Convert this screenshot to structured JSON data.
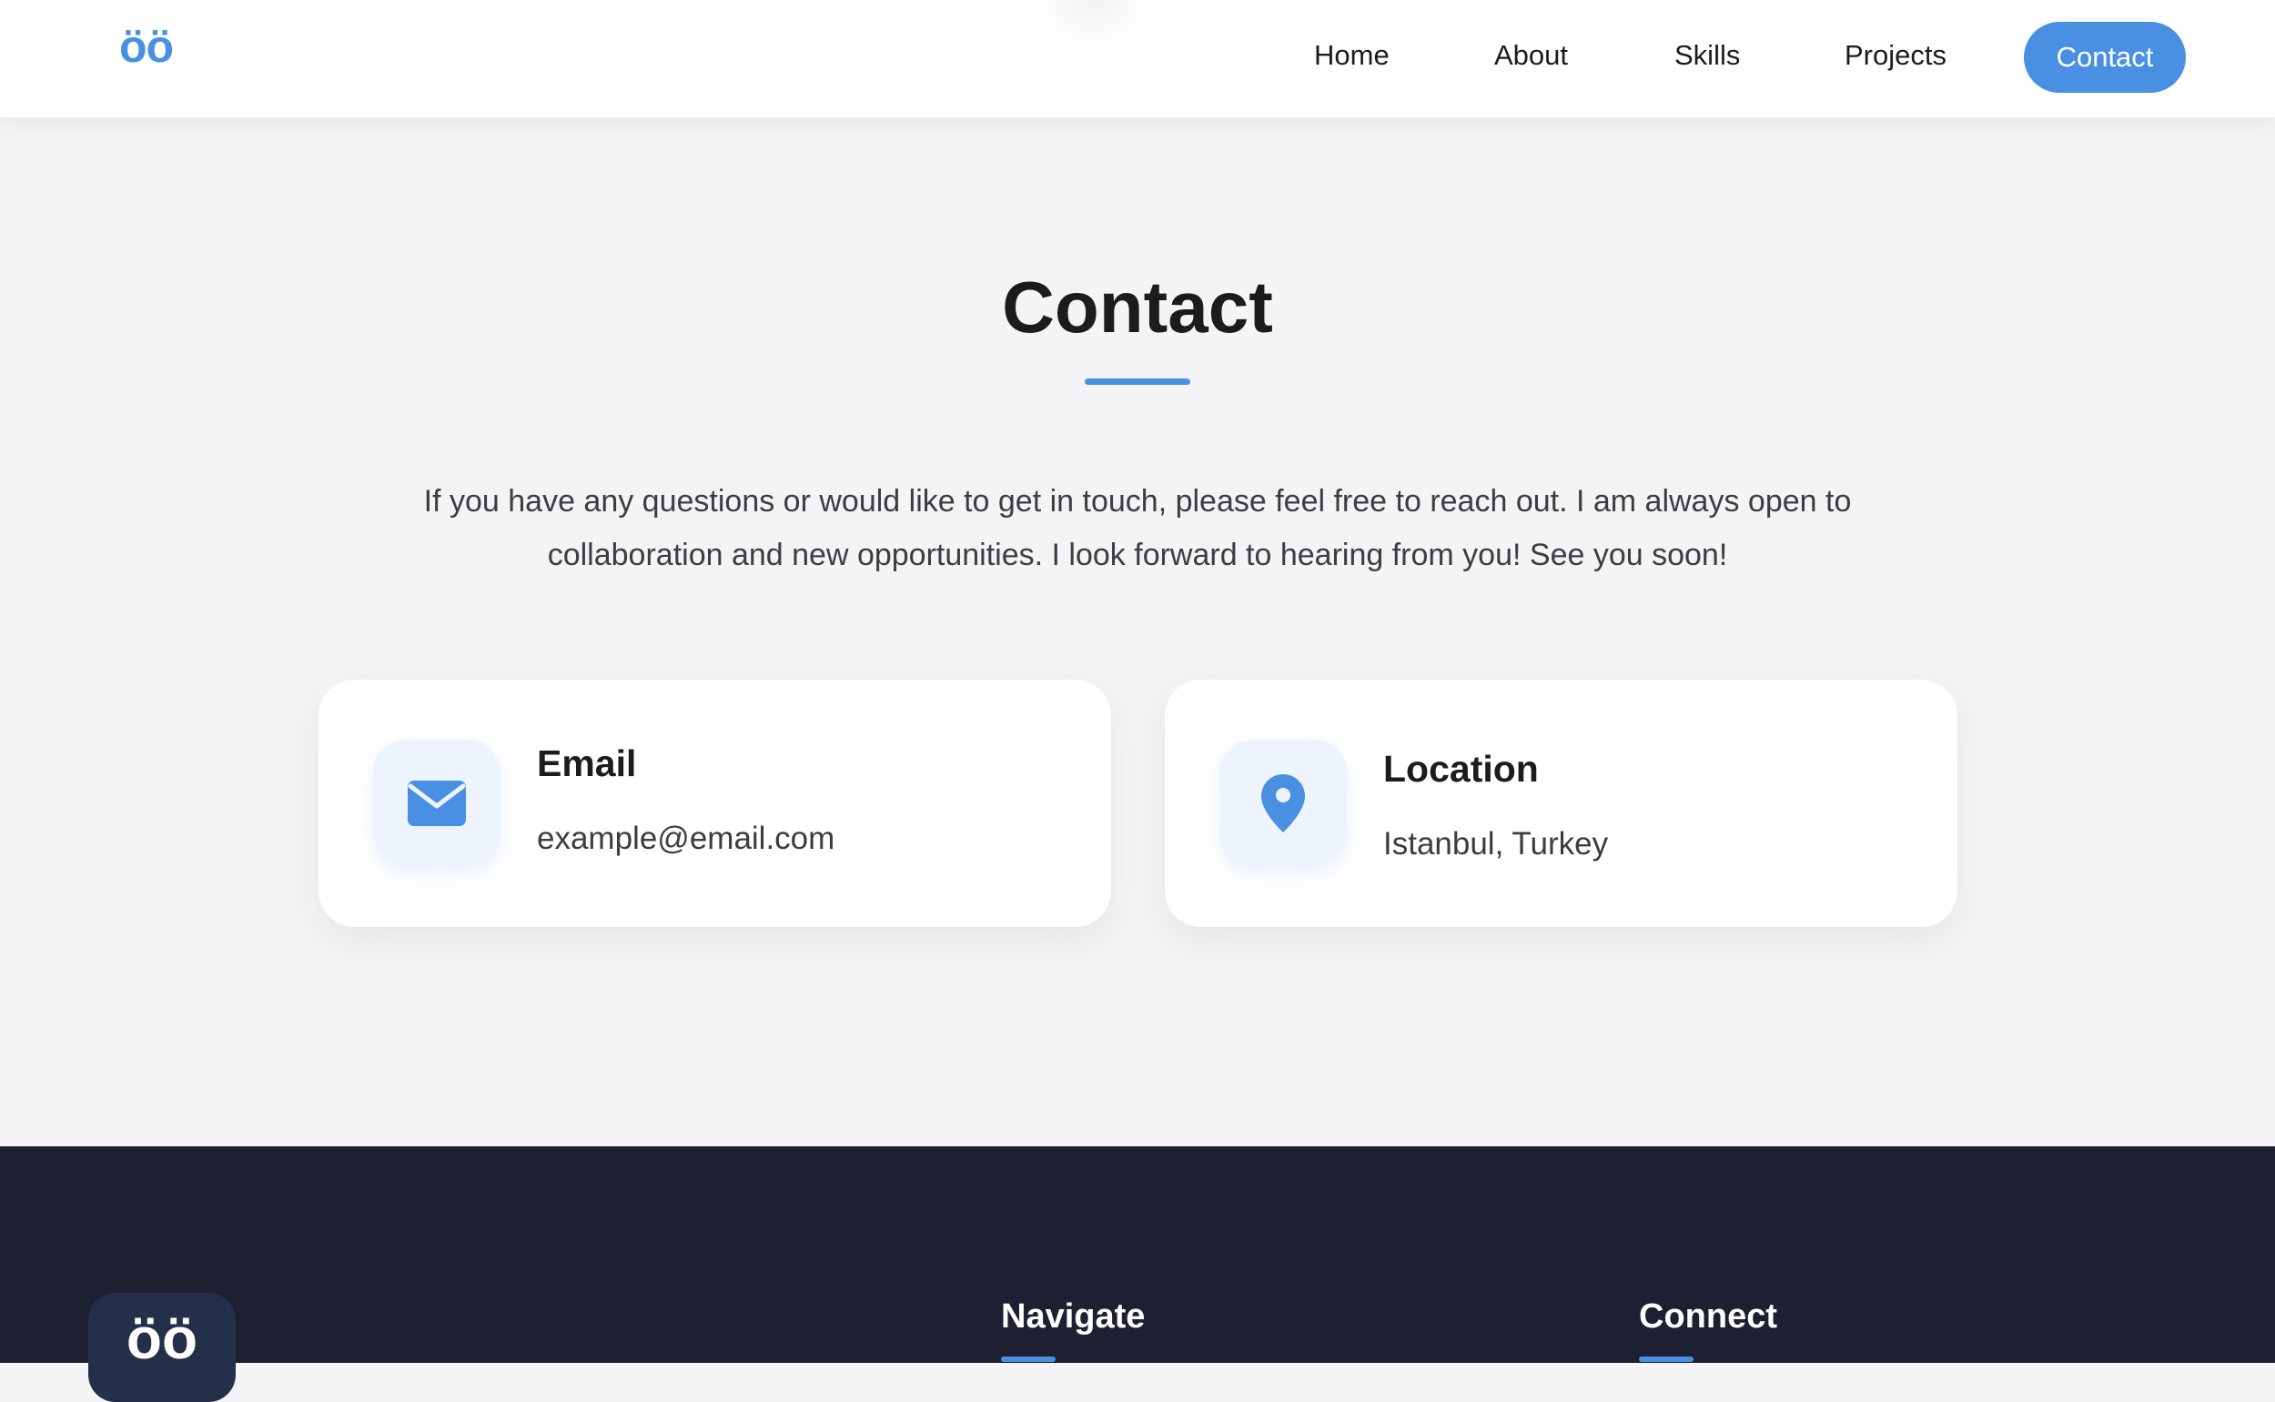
{
  "header": {
    "logo": "öö",
    "nav": [
      {
        "label": "Home"
      },
      {
        "label": "About"
      },
      {
        "label": "Skills"
      },
      {
        "label": "Projects"
      }
    ],
    "cta_label": "Contact"
  },
  "contact": {
    "title": "Contact",
    "intro": "If you have any questions or would like to get in touch, please feel free to reach out. I am always open to collaboration and new opportunities. I look forward to hearing from you! See you soon!",
    "cards": [
      {
        "icon": "envelope-icon",
        "heading": "Email",
        "value": "example@email.com"
      },
      {
        "icon": "map-pin-icon",
        "heading": "Location",
        "value": "Istanbul, Turkey"
      }
    ]
  },
  "footer": {
    "logo": "öö",
    "columns": [
      {
        "title": "Navigate"
      },
      {
        "title": "Connect"
      }
    ]
  },
  "colors": {
    "accent": "#4a90e2",
    "page_background": "#f4f4f6",
    "footer_background": "#1c2030",
    "text_primary": "#1c1c1e"
  }
}
